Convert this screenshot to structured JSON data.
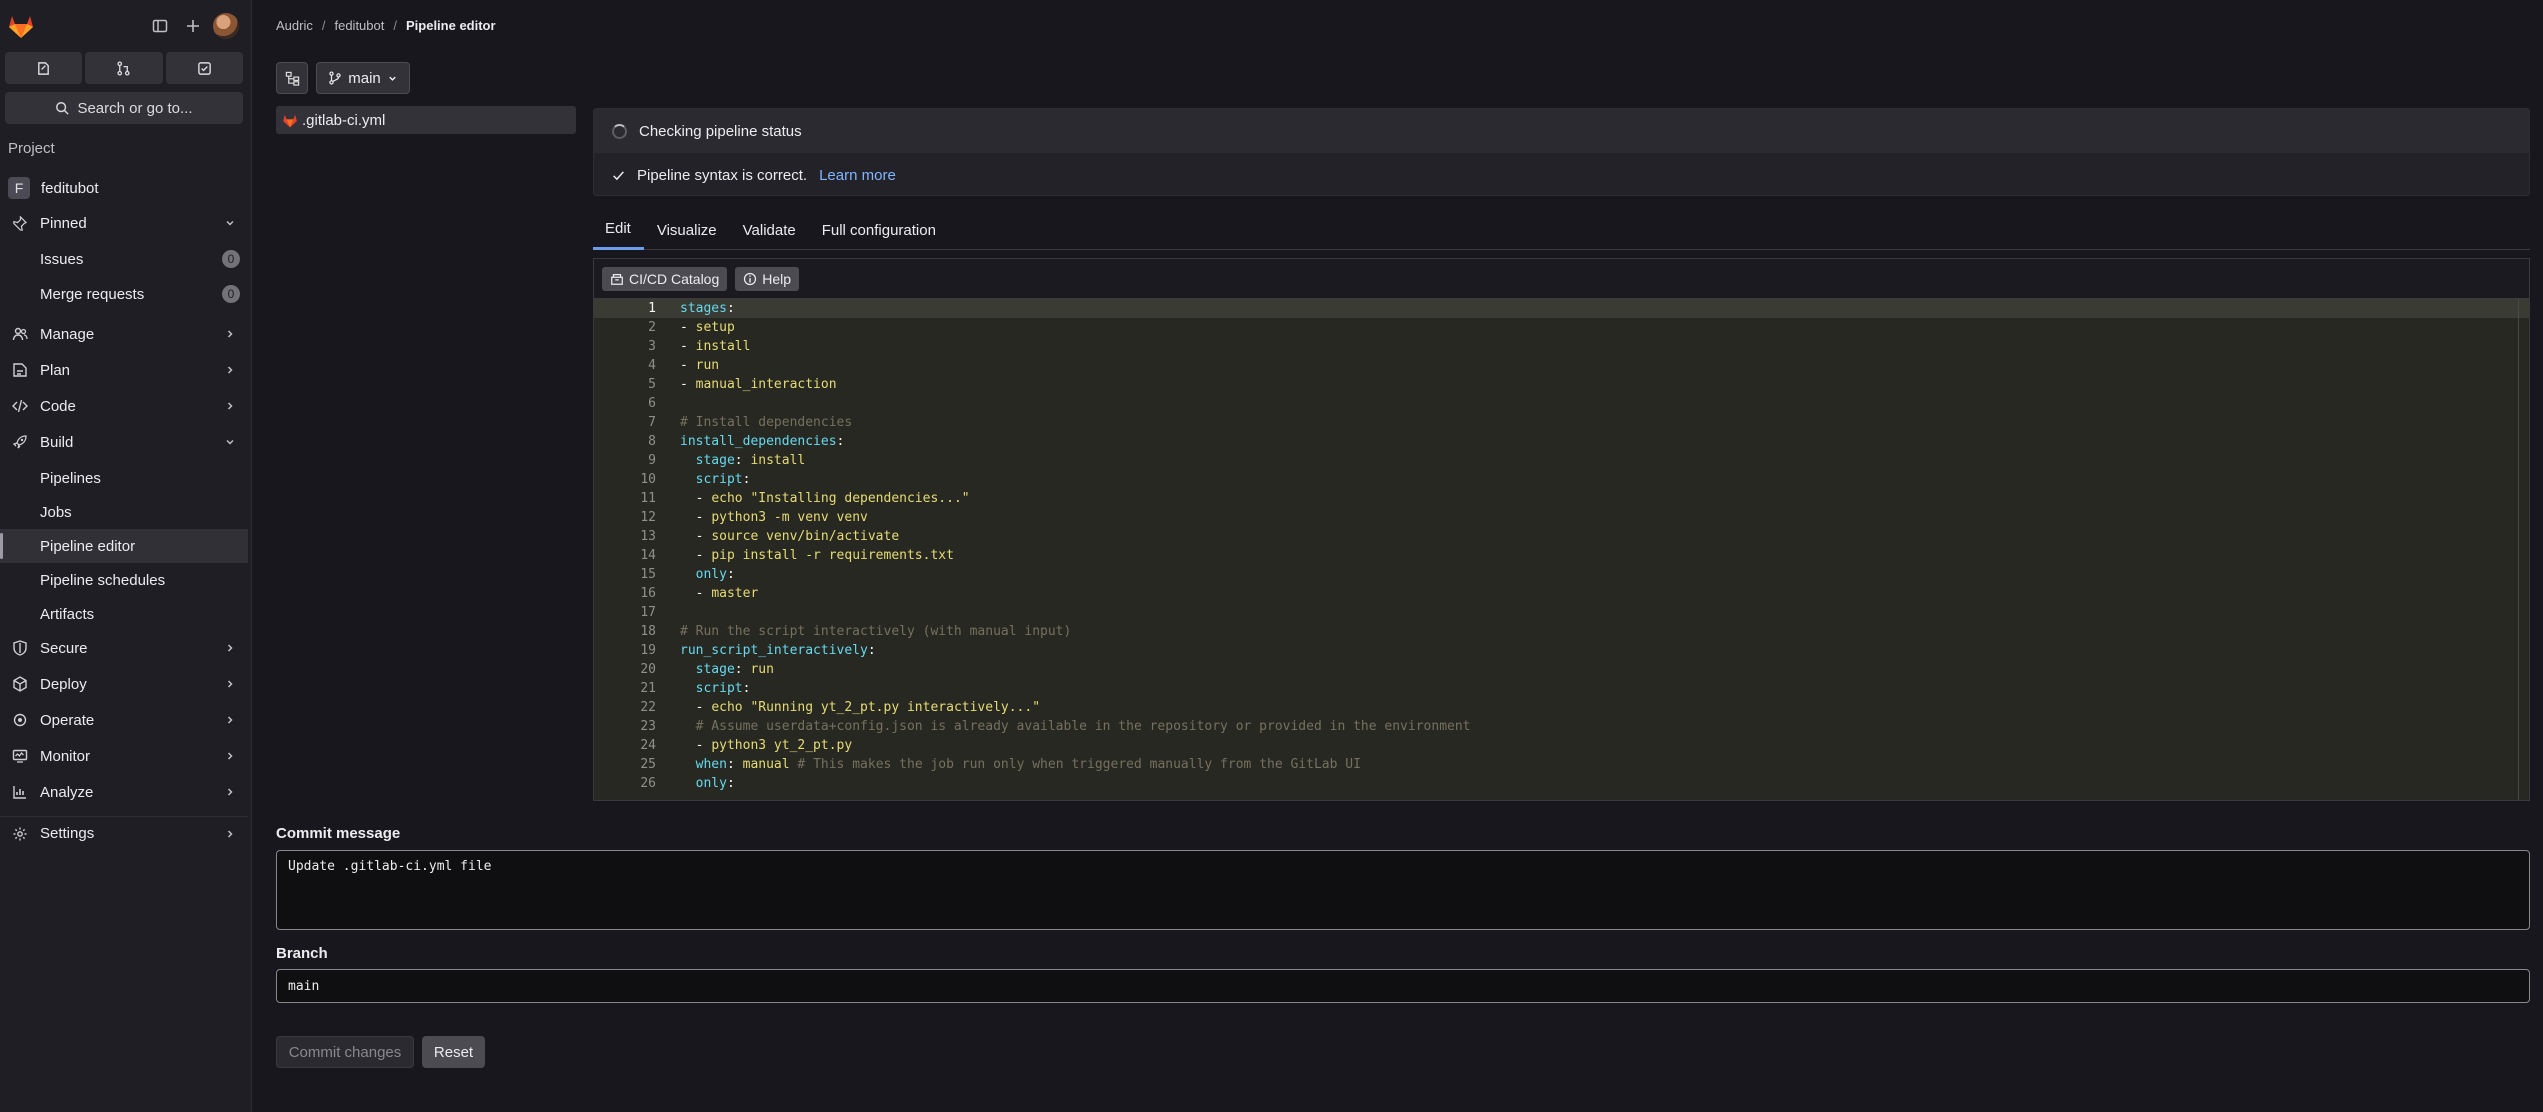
{
  "sidebar": {
    "search_label": "Search or go to...",
    "section_label": "Project",
    "project": {
      "initial": "F",
      "name": "feditubot"
    },
    "items": {
      "pinned": "Pinned",
      "issues": "Issues",
      "issues_count": "0",
      "merge_requests": "Merge requests",
      "merge_requests_count": "0",
      "manage": "Manage",
      "plan": "Plan",
      "code": "Code",
      "build": "Build",
      "pipelines": "Pipelines",
      "jobs": "Jobs",
      "pipeline_editor": "Pipeline editor",
      "pipeline_schedules": "Pipeline schedules",
      "artifacts": "Artifacts",
      "secure": "Secure",
      "deploy": "Deploy",
      "operate": "Operate",
      "monitor": "Monitor",
      "analyze": "Analyze",
      "settings": "Settings"
    }
  },
  "breadcrumb": {
    "group": "Audric",
    "project": "feditubot",
    "current": "Pipeline editor",
    "sep": "/"
  },
  "branch_selector": {
    "value": "main"
  },
  "file_tree": {
    "file": ".gitlab-ci.yml"
  },
  "status": {
    "checking": "Checking pipeline status",
    "syntax": "Pipeline syntax is correct.",
    "learn_more": "Learn more"
  },
  "tabs": [
    "Edit",
    "Visualize",
    "Validate",
    "Full configuration"
  ],
  "editor_toolbar": {
    "catalog": "CI/CD Catalog",
    "help": "Help"
  },
  "code_lines": [
    [
      [
        "k",
        "stages"
      ],
      [
        "p",
        ":"
      ]
    ],
    [
      [
        "p",
        "- "
      ],
      [
        "v",
        "setup"
      ]
    ],
    [
      [
        "p",
        "- "
      ],
      [
        "v",
        "install"
      ]
    ],
    [
      [
        "p",
        "- "
      ],
      [
        "v",
        "run"
      ]
    ],
    [
      [
        "p",
        "- "
      ],
      [
        "v",
        "manual_interaction"
      ]
    ],
    [],
    [
      [
        "cm",
        "# Install dependencies"
      ]
    ],
    [
      [
        "k",
        "install_dependencies"
      ],
      [
        "p",
        ":"
      ]
    ],
    [
      [
        "p",
        "  "
      ],
      [
        "k",
        "stage"
      ],
      [
        "p",
        ": "
      ],
      [
        "v",
        "install"
      ]
    ],
    [
      [
        "p",
        "  "
      ],
      [
        "k",
        "script"
      ],
      [
        "p",
        ":"
      ]
    ],
    [
      [
        "p",
        "  - "
      ],
      [
        "v",
        "echo \"Installing dependencies...\""
      ]
    ],
    [
      [
        "p",
        "  - "
      ],
      [
        "v",
        "python3 -m venv venv"
      ]
    ],
    [
      [
        "p",
        "  - "
      ],
      [
        "v",
        "source venv/bin/activate"
      ]
    ],
    [
      [
        "p",
        "  - "
      ],
      [
        "v",
        "pip install -r requirements.txt"
      ]
    ],
    [
      [
        "p",
        "  "
      ],
      [
        "k",
        "only"
      ],
      [
        "p",
        ":"
      ]
    ],
    [
      [
        "p",
        "  - "
      ],
      [
        "v",
        "master"
      ]
    ],
    [],
    [
      [
        "cm",
        "# Run the script interactively (with manual input)"
      ]
    ],
    [
      [
        "k",
        "run_script_interactively"
      ],
      [
        "p",
        ":"
      ]
    ],
    [
      [
        "p",
        "  "
      ],
      [
        "k",
        "stage"
      ],
      [
        "p",
        ": "
      ],
      [
        "v",
        "run"
      ]
    ],
    [
      [
        "p",
        "  "
      ],
      [
        "k",
        "script"
      ],
      [
        "p",
        ":"
      ]
    ],
    [
      [
        "p",
        "  - "
      ],
      [
        "v",
        "echo \"Running yt_2_pt.py interactively...\""
      ]
    ],
    [
      [
        "p",
        "  "
      ],
      [
        "cm",
        "# Assume userdata+config.json is already available in the repository or provided in the environment"
      ]
    ],
    [
      [
        "p",
        "  - "
      ],
      [
        "v",
        "python3 yt_2_pt.py"
      ]
    ],
    [
      [
        "p",
        "  "
      ],
      [
        "k",
        "when"
      ],
      [
        "p",
        ": "
      ],
      [
        "v",
        "manual"
      ],
      [
        "p",
        " "
      ],
      [
        "cm",
        "# This makes the job run only when triggered manually from the GitLab UI"
      ]
    ],
    [
      [
        "p",
        "  "
      ],
      [
        "k",
        "only"
      ],
      [
        "p",
        ":"
      ]
    ]
  ],
  "commit": {
    "message_label": "Commit message",
    "message_value": "Update .gitlab-ci.yml file",
    "branch_label": "Branch",
    "branch_value": "main",
    "commit_button": "Commit changes",
    "reset_button": "Reset"
  }
}
